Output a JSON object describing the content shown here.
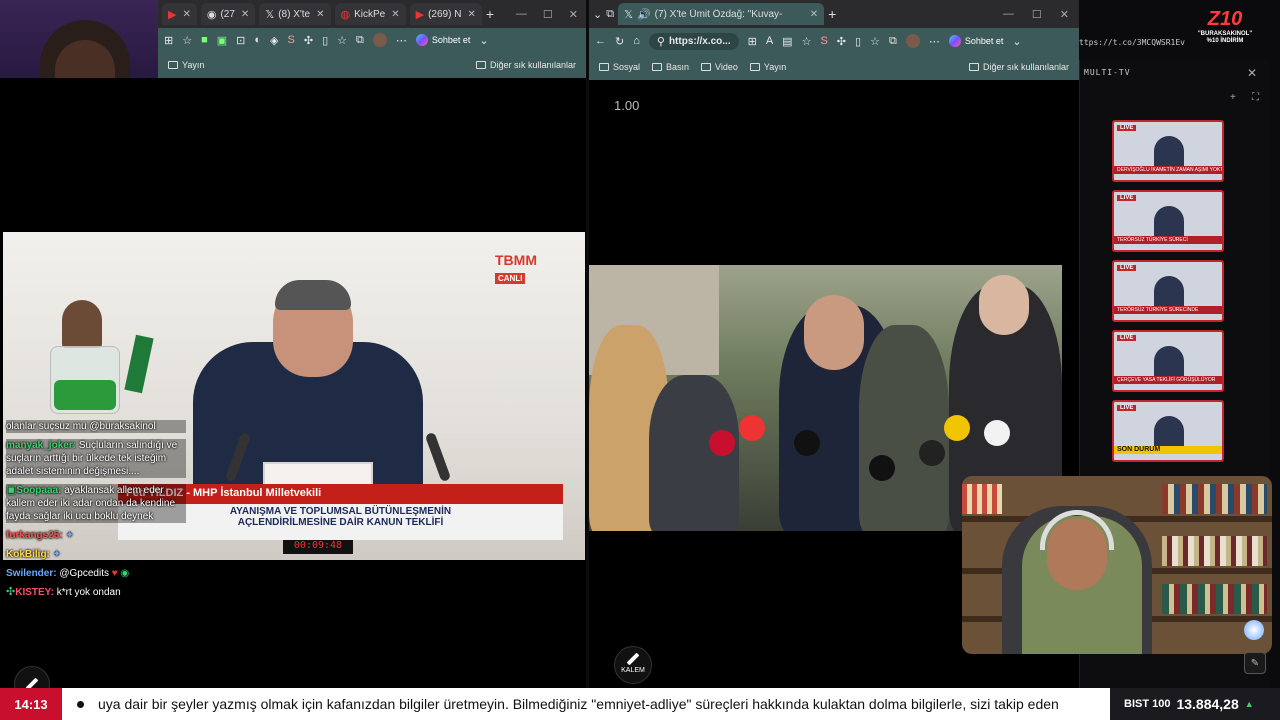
{
  "left_browser": {
    "tabs": [
      {
        "label": "",
        "icon": "youtube-icon"
      },
      {
        "label": "(27",
        "icon": "record-icon"
      },
      {
        "label": "(8) X'te",
        "icon": "x-icon"
      },
      {
        "label": "KickPe",
        "icon": "kick-icon"
      },
      {
        "label": "(269) N",
        "icon": "youtube-icon"
      }
    ],
    "sohbet_label": "Sohbet et",
    "favorites": [
      "Yayın"
    ],
    "other_favorites": "Diğer sık kullanılanlar"
  },
  "right_browser": {
    "active_tab": "(7) X'te Ümit Özdağ: \"Kuvay-",
    "url": "https://x.co...",
    "sohbet_label": "Sohbet et",
    "favorites": [
      "Sosyal",
      "Basın",
      "Video",
      "Yayın"
    ],
    "other_favorites": "Diğer sık kullanılanlar",
    "speed_label": "1.00"
  },
  "left_video": {
    "logo": "TBMM",
    "live_label": "CANLI",
    "speaker_line": "Feti YILDIZ - MHP İstanbul Milletvekili",
    "bill_line_1": "AYANIŞMA VE TOPLUMSAL BÜTÜNLEŞMENİN",
    "bill_line_2": "AÇLENDİRİLMESİNE DAİR KANUN TEKLİFİ",
    "clock": "00:09:48"
  },
  "chat": [
    {
      "user": "",
      "text": "olanlar suçsuz mu @buraksakinol",
      "user_color": "#ffffff"
    },
    {
      "user": "manyak_joker:",
      "text": " Suçluların salındığı ve suçların arttığı bir ülkede tek isteğim adalet sisteminin değişmesi....",
      "user_color": "#3bd16f"
    },
    {
      "user": "Soopaaa:",
      "text": " ayaklansak allem eder kallem eder iki adar ondan da kendine fayda sağlar iki ucu boklu deynek",
      "user_color": "#3bd16f"
    },
    {
      "user": "furkangs25:",
      "text": " ",
      "user_color": "#ff4d4d"
    },
    {
      "user": "KokBilig:",
      "text": " ",
      "user_color": "#ffd84d"
    },
    {
      "user": "Swilender:",
      "text": " @Gpcedits",
      "user_color": "#6aa8ff"
    },
    {
      "user": "KISTEY:",
      "text": " k*rt yok ondan",
      "user_color": "#ff4d6a"
    }
  ],
  "multitv": {
    "title": "MULTI-TV",
    "thumbs": [
      {
        "live": "LIVE",
        "band": "DERVİŞOĞLU İKAMETİN ZAMAN AŞIMI YOKTUR"
      },
      {
        "live": "LIVE",
        "band": "TERÖRSÜZ TÜRKİYE SÜRECİ"
      },
      {
        "live": "LIVE",
        "band": "TERÖRSÜZ TÜRKİYE SÜRECİNDE"
      },
      {
        "live": "LIVE",
        "band": "ÇERÇEVE YASA TEKLİFİ GÖRÜŞÜLÜYOR"
      },
      {
        "live": "LIVE",
        "band": "SON DURUM"
      }
    ],
    "url_snippet": "ttps://t.co/3MCQWSR1Ev"
  },
  "zio": {
    "logo": "Z10",
    "promo_line_1": "\"BURAKSAKINOL\"",
    "promo_line_2": "%10 İNDİRİM"
  },
  "kalem_label": "KALEM",
  "ticker": {
    "time": "14:13",
    "text": "uya dair bir şeyler yazmış olmak için kafanızdan bilgiler üretmeyin. Bilmediğiniz \"emniyet-adliye\" süreçleri hakkında kulaktan dolma bilgilerle, sizi takip eden",
    "bist_label": "BIST 100",
    "bist_value": "13.884,28",
    "bist_trend": "▲"
  },
  "colors": {
    "accent_teal": "#3d5a5a",
    "live_red": "#c8102e",
    "chat_green": "#3bd16f"
  }
}
